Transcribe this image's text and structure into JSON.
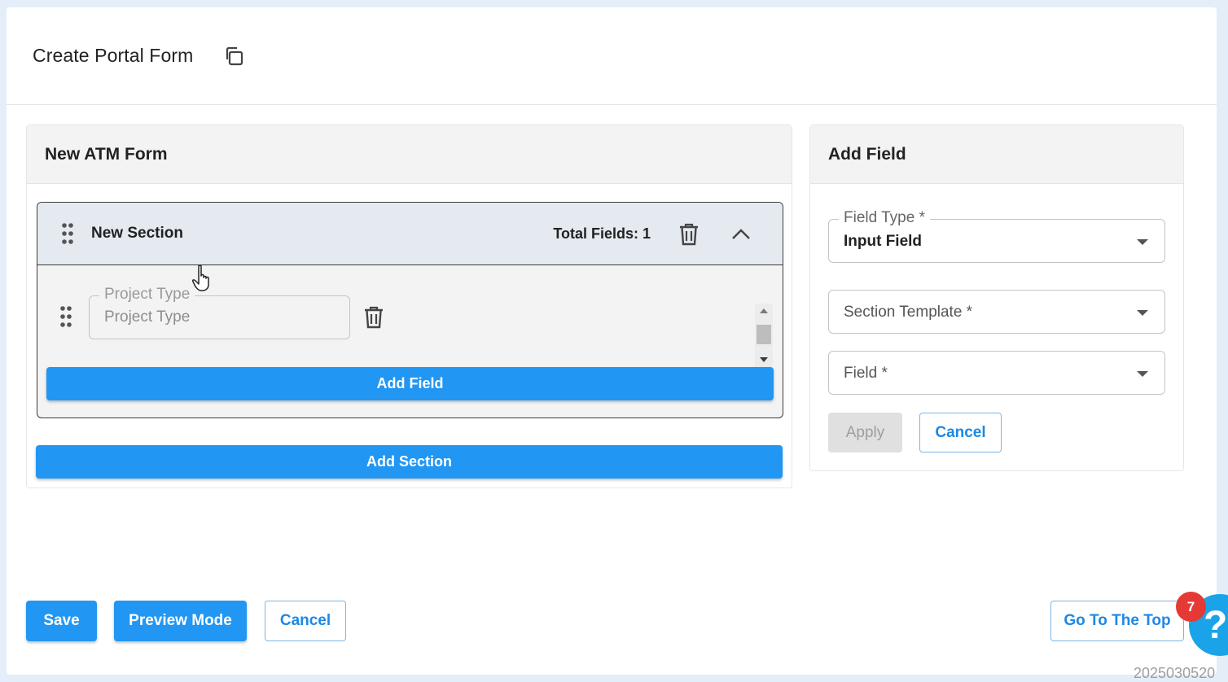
{
  "header": {
    "title": "Create Portal Form",
    "copy_icon": "copy-icon"
  },
  "form_card": {
    "title": "New ATM Form",
    "section": {
      "title": "New Section",
      "total_fields": "Total Fields: 1",
      "fields": [
        {
          "legend": "Project Type",
          "value": "Project Type"
        }
      ],
      "add_field_label": "Add Field"
    },
    "add_section_label": "Add Section"
  },
  "side_card": {
    "title": "Add Field",
    "field_type": {
      "label": "Field Type *",
      "value": "Input Field"
    },
    "section_template": {
      "placeholder": "Section Template *"
    },
    "field": {
      "placeholder": "Field *"
    },
    "apply_label": "Apply",
    "cancel_label": "Cancel"
  },
  "footer": {
    "save_label": "Save",
    "preview_label": "Preview Mode",
    "cancel_label": "Cancel",
    "top_label": "Go To The Top"
  },
  "help": {
    "symbol": "?",
    "badge_count": "7"
  },
  "build_stamp": "2025030520",
  "colors": {
    "primary": "#2196f3",
    "badge": "#e53935",
    "help": "#1aa3e8"
  }
}
